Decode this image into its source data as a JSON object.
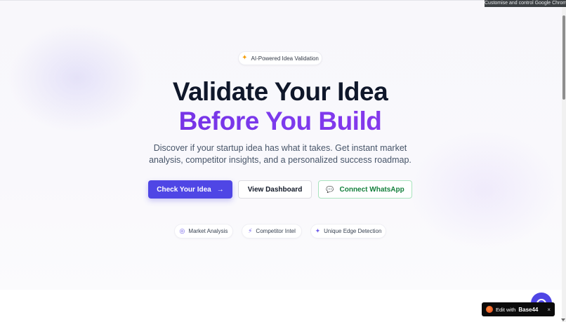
{
  "browser": {
    "automation_banner": "Customise and control Google Chrome"
  },
  "hero": {
    "badge": {
      "icon": "sparkles-icon",
      "label": "AI-Powered Idea Validation"
    },
    "title_line1": "Validate Your Idea",
    "title_line2": "Before You Build",
    "subtitle": "Discover if your startup idea has what it takes. Get instant market analysis, competitor insights, and a personalized success roadmap.",
    "buttons": {
      "primary": {
        "label": "Check Your Idea",
        "icon": "arrow-right-icon"
      },
      "secondary": {
        "label": "View Dashboard"
      },
      "whatsapp": {
        "label": "Connect WhatsApp",
        "icon": "chat-bubble-icon"
      }
    },
    "features": [
      {
        "icon": "target-icon",
        "label": "Market Analysis"
      },
      {
        "icon": "zap-icon",
        "label": "Competitor Intel"
      },
      {
        "icon": "sparkles-icon",
        "label": "Unique Edge Detection"
      }
    ],
    "colors": {
      "primary": "#4f46e5",
      "title_dark": "#0f172a",
      "title_gradient": [
        "#6d28d9",
        "#9333ea"
      ],
      "whatsapp_green": "#15803d"
    }
  },
  "widget": {
    "edit_prefix": "Edit with",
    "brand": "Base44",
    "close": "×"
  }
}
